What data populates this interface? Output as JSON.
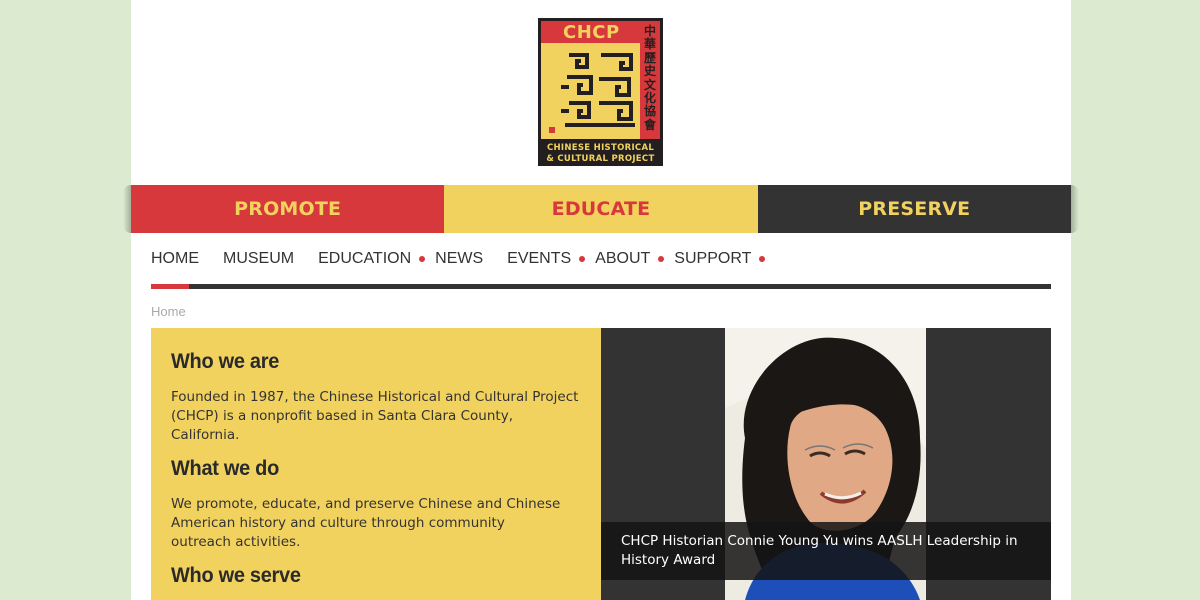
{
  "logo": {
    "abbr": "CHCP",
    "cjk": "中華歷史文化協會",
    "line1": "CHINESE HISTORICAL",
    "line2": "& CULTURAL PROJECT"
  },
  "slogans": [
    "PROMOTE",
    "EDUCATE",
    "PRESERVE"
  ],
  "nav": {
    "items": [
      {
        "label": "HOME",
        "dot": false
      },
      {
        "label": "MUSEUM",
        "dot": false
      },
      {
        "label": "EDUCATION",
        "dot": true
      },
      {
        "label": "NEWS",
        "dot": false
      },
      {
        "label": "EVENTS",
        "dot": true
      },
      {
        "label": "ABOUT",
        "dot": true
      },
      {
        "label": "SUPPORT",
        "dot": true
      }
    ],
    "active": "HOME"
  },
  "breadcrumb": "Home",
  "about": {
    "who_title": "Who we are",
    "who_text": "Founded in 1987, the Chinese Historical and Cultural Project (CHCP) is a nonprofit based in Santa Clara County, California.",
    "what_title": "What we do",
    "what_text": "We promote, educate, and preserve Chinese and Chinese American history and culture through community outreach activities.",
    "serve_title": "Who we serve"
  },
  "feature": {
    "caption": "CHCP Historian Connie Young Yu wins AASLH Leadership in History Award"
  },
  "colors": {
    "red": "#d7383b",
    "yellow": "#f2d25e",
    "dark": "#333333",
    "background": "#dcebd0"
  }
}
